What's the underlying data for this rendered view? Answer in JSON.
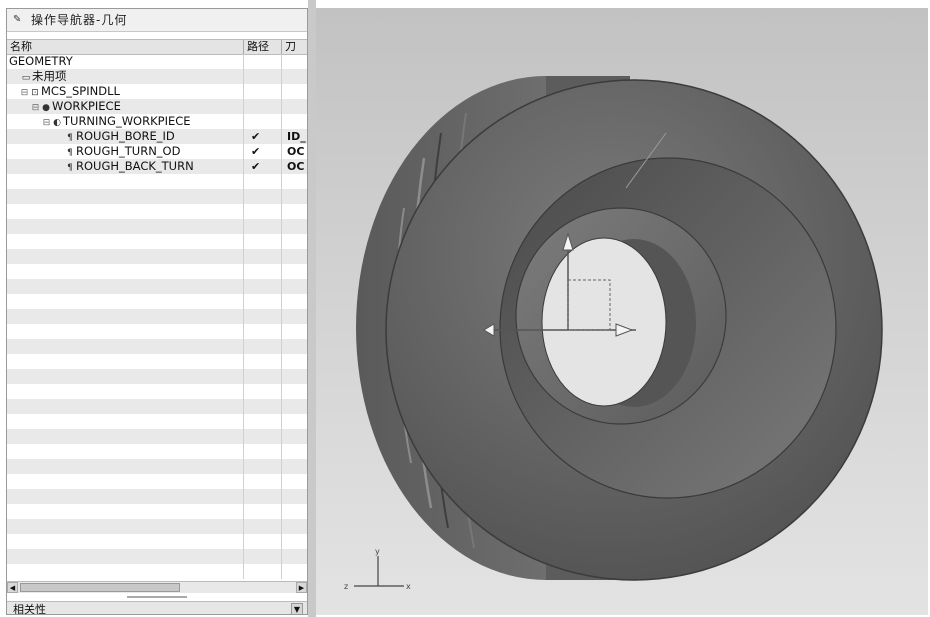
{
  "navigator": {
    "title": "操作导航器-几何",
    "columns": {
      "name": "名称",
      "path": "路径",
      "tool": "刀"
    },
    "rows": [
      {
        "label": "GEOMETRY",
        "indent": 0,
        "check": "",
        "tool": "",
        "icon": "",
        "expand": ""
      },
      {
        "label": "未用项",
        "indent": 1,
        "check": "",
        "tool": "",
        "icon": "▭",
        "expand": ""
      },
      {
        "label": "MCS_SPINDLL",
        "indent": 1,
        "check": "",
        "tool": "",
        "icon": "⊡",
        "expand": "⊟"
      },
      {
        "label": "WORKPIECE",
        "indent": 2,
        "check": "",
        "tool": "",
        "icon": "●",
        "expand": "⊟"
      },
      {
        "label": "TURNING_WORKPIECE",
        "indent": 3,
        "check": "",
        "tool": "",
        "icon": "◐",
        "expand": "⊟"
      },
      {
        "label": "ROUGH_BORE_ID",
        "indent": 5,
        "check": "✔",
        "tool": "ID_",
        "icon": "¶",
        "expand": ""
      },
      {
        "label": "ROUGH_TURN_OD",
        "indent": 5,
        "check": "✔",
        "tool": "OC",
        "icon": "¶",
        "expand": ""
      },
      {
        "label": "ROUGH_BACK_TURN",
        "indent": 5,
        "check": "✔",
        "tool": "OC",
        "icon": "¶",
        "expand": ""
      }
    ],
    "dependencies_label": "相关性"
  },
  "viewport": {
    "triad_labels": {
      "x": "x",
      "y": "y",
      "z": "z"
    }
  }
}
